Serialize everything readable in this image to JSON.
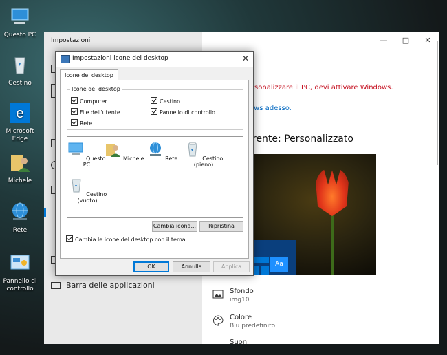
{
  "desktop": {
    "icons": [
      {
        "label": "Questo PC"
      },
      {
        "label": "Cestino"
      },
      {
        "label": "Microsoft Edge"
      },
      {
        "label": "Michele"
      },
      {
        "label": "Rete"
      },
      {
        "label": "Pannello di controllo"
      }
    ]
  },
  "settings": {
    "title": "Impostazioni",
    "sidebar": {
      "barra_label": "Barra delle applicazioni"
    },
    "warning": "er personalizzare il PC, devi attivare Windows.",
    "activate_link": "ows adesso.",
    "theme_heading": "rente: Personalizzato",
    "options": [
      {
        "name": "Sfondo",
        "sub": "img10"
      },
      {
        "name": "Colore",
        "sub": "Blu predefinito"
      },
      {
        "name": "Suoni",
        "sub": ""
      }
    ],
    "preview_tile_label": "Aa"
  },
  "dialog": {
    "title": "Impostazioni icone del desktop",
    "tab_label": "Icone del desktop",
    "group_legend": "Icone del desktop",
    "checkboxes": [
      {
        "label": "Computer",
        "checked": true
      },
      {
        "label": "Cestino",
        "checked": true
      },
      {
        "label": "File dell'utente",
        "checked": true
      },
      {
        "label": "Pannello di controllo",
        "checked": true
      },
      {
        "label": "Rete",
        "checked": true
      }
    ],
    "icon_list": [
      {
        "label": "Questo PC"
      },
      {
        "label": "Michele"
      },
      {
        "label": "Rete"
      },
      {
        "label": "Cestino (pieno)"
      },
      {
        "label": "Cestino (vuoto)"
      }
    ],
    "change_icon_button": "Cambia icona...",
    "restore_button": "Ripristina",
    "theme_checkbox": "Cambia le icone del desktop con il tema",
    "ok_button": "OK",
    "cancel_button": "Annulla",
    "apply_button": "Applica"
  }
}
